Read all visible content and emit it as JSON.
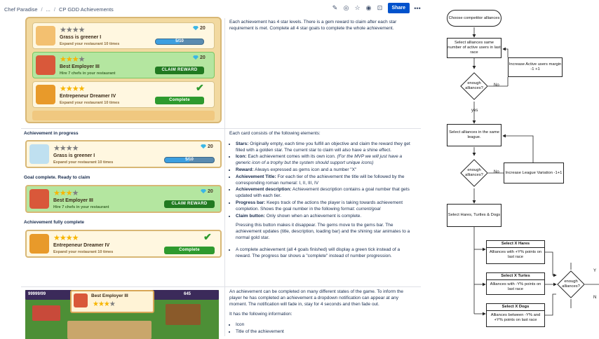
{
  "breadcrumb": {
    "space": "Chef Paradise",
    "ellipsis": "...",
    "page": "CP GDD Achievements"
  },
  "toolbar": {
    "share_label": "Share"
  },
  "row1": {
    "text": "Each achievement has 4 star levels. There is a gem reward to claim after each star requirement is met. Complete all 4 star goals to complete the whole achievement.",
    "cards": [
      {
        "title": "Grass is greener I",
        "desc": "Expand your restaurant 10 times",
        "gems": "20",
        "progress_label": "5/10",
        "progress": 0.5,
        "stars_filled": 0
      },
      {
        "title": "Best Employer III",
        "desc": "Hire 7 chefs in your restaurant",
        "gems": "20",
        "button": "CLAIM REWARD",
        "stars_filled": 3
      },
      {
        "title": "Entrepeneur Dreamer IV",
        "desc": "Expand your restaurant 10 times",
        "button": "Complete",
        "stars_filled": 4
      }
    ]
  },
  "row2": {
    "heading_progress": "Achievement in progress",
    "heading_goal": "Goal complete. Ready to claim",
    "heading_full": "Achievement fully complete",
    "card_progress": {
      "title": "Grass is greener I",
      "desc": "Expand your restaurant 10 times",
      "gems": "20",
      "progress_label": "5/10",
      "progress": 0.5
    },
    "card_goal": {
      "title": "Best Employer III",
      "desc": "Hire 7 chefs in your restaurant",
      "gems": "20",
      "button": "CLAIM REWARD"
    },
    "card_full": {
      "title": "Entrepeneur Dreamer IV",
      "desc": "Expand your restaurant 10 times",
      "button": "Complete"
    },
    "intro": "Each card consists of the following elements:",
    "items": [
      {
        "term": "Stars:",
        "text": " Originally empty, each time you fulfill an objective and claim the reward they get filled with a golden star. The current star to claim will also have a shine effect."
      },
      {
        "term": "Icon:",
        "text": " Each achievement comes with its own icon. ",
        "italic": "(For the MVP we will just have a generic icon of a trophy but the system should support unique icons)"
      },
      {
        "term": "Reward:",
        "text": " Always expressed as gems icon and a number \"X\""
      },
      {
        "term": "Achievement Title:",
        "text": " For each tier of the achievement the title will be followed by the corresponding roman numeral: I, II, III, IV"
      },
      {
        "term": "Achievement description:",
        "text": " Achievement description contains a goal number that gets updated with each tier."
      },
      {
        "term": "Progress bar:",
        "text": " Keeps track of the actions the player is taking towards achievement completion. Shows the goal number in the following format: ",
        "italic": "current/goal"
      },
      {
        "term": "Claim button:",
        "text": " Only shown when an achievement is complete."
      }
    ],
    "claim_note": "Pressing this button makes it disappear. The gems move to the gems bar. The achievement updates (title, description, loading bar) and the shining star animates to a normal gold star.",
    "complete_note": "A complete achievement (all 4 goals finished) will display a green tick instead of a reward. The progress bar shows a \"complete\" instead of number progression."
  },
  "row3": {
    "notif_title": "Best Employer III",
    "hud_gems": "99999/99",
    "hud_coins": "645",
    "p1": "An achievement can be completed on many different states of the game. To inform the player he has completed an achievement a dropdown notification can appear at any moment. The notification will fade in, stay for 4 seconds and then fade out.",
    "p2": "It has the following information:",
    "list": [
      "Icon",
      "Title of the achievement"
    ]
  },
  "flowchart": {
    "start": "Choose competitor alliances",
    "select_active": "Select alliances same number of active users in last race",
    "q1": "enough alliances?",
    "no1": "No",
    "increase_active": "Increase Active users margin -1 +1",
    "yes1": "yes",
    "select_league": "Select alliances in the same league.",
    "q2": "enough alliances?",
    "no2": "No",
    "increase_league": "Increase League Variation -1+1",
    "select_hares": "Select Hares, Turtles & Dogs",
    "hares_title": "Select X Hares",
    "hares_text": "Alliances with +Y% points on last race",
    "turtles_title": "Select X Turtes",
    "turtles_text": "Alliances with -Y% points on last race",
    "dogs_title": "Select X Dogs",
    "dogs_text": "Alliances between -Y% and +Y% points on last race",
    "q3": "enough alliances?",
    "y3": "Y",
    "n3": "N"
  }
}
